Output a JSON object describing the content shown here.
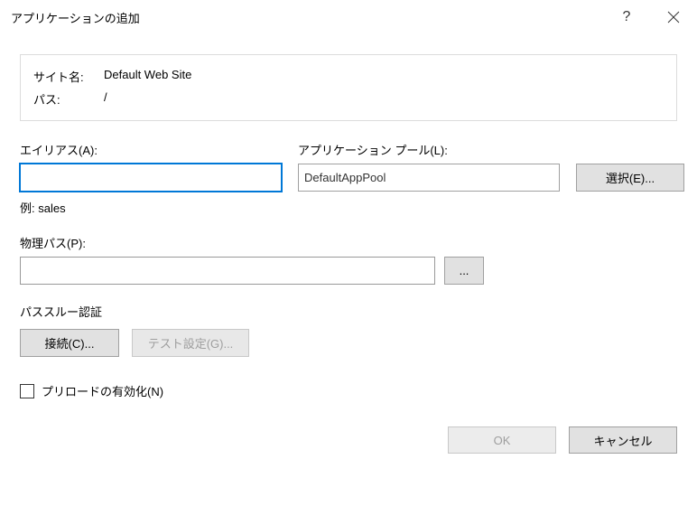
{
  "titlebar": {
    "title": "アプリケーションの追加",
    "help": "?",
    "close": "×"
  },
  "info": {
    "site_label": "サイト名:",
    "site_value": "Default Web Site",
    "path_label": "パス:",
    "path_value": "/"
  },
  "alias": {
    "label": "エイリアス(A):",
    "value": "",
    "hint": "例: sales"
  },
  "apppool": {
    "label": "アプリケーション プール(L):",
    "value": "DefaultAppPool",
    "select_btn": "選択(E)..."
  },
  "physical": {
    "label": "物理パス(P):",
    "value": "",
    "browse": "..."
  },
  "auth": {
    "section": "パススルー認証",
    "connect_btn": "接続(C)...",
    "test_btn": "テスト設定(G)..."
  },
  "preload": {
    "label": "プリロードの有効化(N)",
    "checked": false
  },
  "dialog": {
    "ok": "OK",
    "cancel": "キャンセル"
  }
}
